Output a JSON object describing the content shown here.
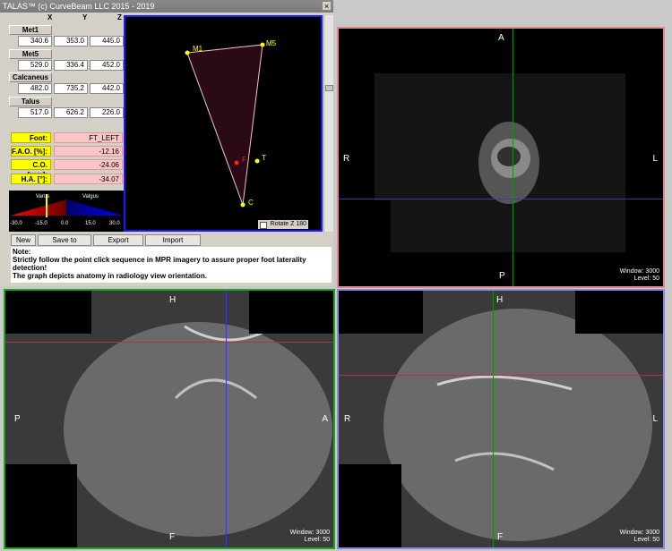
{
  "window": {
    "title": "TALAS™ (c) CurveBeam LLC 2015 - 2019",
    "close_glyph": "×"
  },
  "columns": [
    "X",
    "Y",
    "Z"
  ],
  "points": [
    {
      "name": "Met1",
      "x": "340.6",
      "y": "353.0",
      "z": "445.0"
    },
    {
      "name": "Met5",
      "x": "529.0",
      "y": "336.4",
      "z": "452.0"
    },
    {
      "name": "Calcaneus",
      "x": "482.0",
      "y": "735.2",
      "z": "442.0"
    },
    {
      "name": "Talus",
      "x": "517.0",
      "y": "626.2",
      "z": "226.0"
    }
  ],
  "metrics": [
    {
      "label": "Foot:",
      "value": "FT_LEFT"
    },
    {
      "label": "F.A.O. [%]:",
      "value": "-12.16"
    },
    {
      "label": "C.O. [mm]:",
      "value": "-24.06"
    },
    {
      "label": "H.A. [°]:",
      "value": "-34.07"
    }
  ],
  "scale": {
    "left_label": "Varus",
    "right_label": "Valgus",
    "ticks": [
      "-30.0",
      "-15.0",
      "0.0",
      "15.0",
      "30.0"
    ],
    "colors": {
      "varus": "#cc0000",
      "valgus": "#0000cc"
    }
  },
  "graph": {
    "points": [
      {
        "label": "M1",
        "color": "#ffff00"
      },
      {
        "label": "M5",
        "color": "#ffff00"
      },
      {
        "label": "T",
        "color": "#ffff00"
      },
      {
        "label": "C",
        "color": "#ffff00"
      },
      {
        "label": "F",
        "color": "#ff2222"
      }
    ],
    "rotate_label": "Rotate Z 180"
  },
  "buttons": [
    "New",
    "Save to Database",
    "Export Database",
    "Import Pathologies"
  ],
  "note": {
    "heading": "Note:",
    "line1": "Strictly follow the point click sequence in MPR imagery to assure proper foot laterality detection!",
    "line2": "The graph depicts anatomy in radiology view orientation."
  },
  "viewports": {
    "axial": {
      "top": "A",
      "bottom": "P",
      "left": "R",
      "right": "L",
      "window": "Window: 3000",
      "level": "Level: 50",
      "border": "#e08a8a"
    },
    "sagittal": {
      "top": "H",
      "bottom": "F",
      "left": "P",
      "right": "A",
      "window": "Window: 3000",
      "level": "Level: 50",
      "border": "#1aa81a"
    },
    "coronal": {
      "top": "H",
      "bottom": "F",
      "left": "R",
      "right": "L",
      "window": "Window: 3000",
      "level": "Level: 50",
      "border": "#8888dd"
    }
  }
}
